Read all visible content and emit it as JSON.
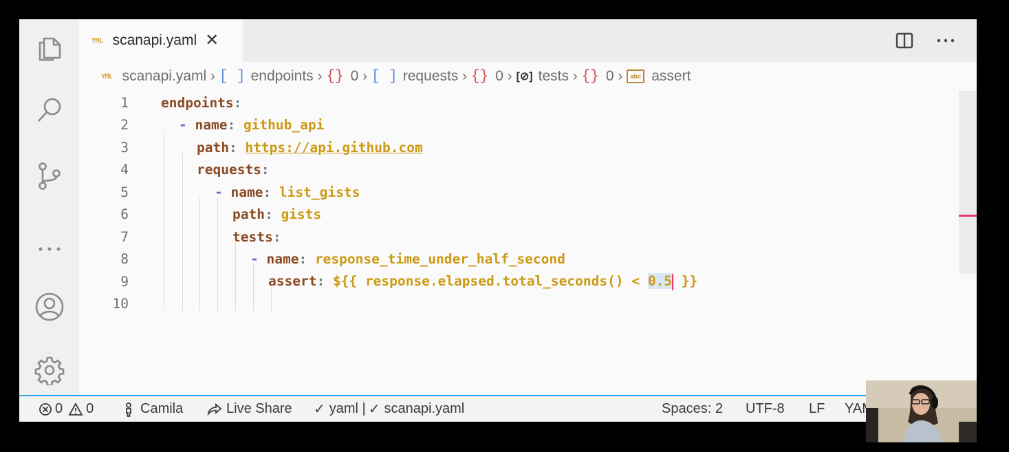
{
  "tab": {
    "icon": "yaml-file-icon",
    "icon_text": "YML",
    "title": "scanapi.yaml",
    "close": "✕"
  },
  "breadcrumb": [
    {
      "kind": "file",
      "label": "scanapi.yaml"
    },
    {
      "kind": "array",
      "symbol": "[ ]",
      "label": "endpoints"
    },
    {
      "kind": "object",
      "symbol": "{}",
      "label": "0"
    },
    {
      "kind": "array",
      "symbol": "[ ]",
      "label": "requests"
    },
    {
      "kind": "object",
      "symbol": "{}",
      "label": "0"
    },
    {
      "kind": "namespace",
      "symbol": "[⊘]",
      "label": "tests"
    },
    {
      "kind": "object",
      "symbol": "{}",
      "label": "0"
    },
    {
      "kind": "string",
      "symbol": "abc",
      "label": "assert"
    }
  ],
  "editor": {
    "lines": [
      {
        "num": "1",
        "dash": "",
        "key": "endpoints",
        "colon": ":",
        "value": ""
      },
      {
        "num": "2",
        "dash": "- ",
        "key": "name",
        "colon": ": ",
        "value": "github_api"
      },
      {
        "num": "3",
        "dash": "",
        "key": "path",
        "colon": ": ",
        "value": "https://api.github.com"
      },
      {
        "num": "4",
        "dash": "",
        "key": "requests",
        "colon": ":",
        "value": ""
      },
      {
        "num": "5",
        "dash": "- ",
        "key": "name",
        "colon": ": ",
        "value": "list_gists"
      },
      {
        "num": "6",
        "dash": "",
        "key": "path",
        "colon": ": ",
        "value": "gists"
      },
      {
        "num": "7",
        "dash": "",
        "key": "tests",
        "colon": ":",
        "value": ""
      },
      {
        "num": "8",
        "dash": "- ",
        "key": "name",
        "colon": ": ",
        "value": "response_time_under_half_second"
      },
      {
        "num": "9",
        "dash": "",
        "key": "assert",
        "colon": ": ",
        "value_pre": "${{ response.elapsed.total_seconds() < ",
        "value_sel": "0.5",
        "value_post": " }}"
      },
      {
        "num": "10",
        "dash": "",
        "key": "",
        "colon": "",
        "value": ""
      }
    ]
  },
  "status": {
    "errors": "0",
    "warnings": "0",
    "user": "Camila",
    "live_share": "Live Share",
    "yaml_check": "yaml | ",
    "file_check": "scanapi.yaml",
    "spaces": "Spaces: 2",
    "encoding": "UTF-8",
    "eol": "LF",
    "language": "YAML"
  },
  "colors": {
    "accent": "#2aa1e6",
    "cursor": "#e8396b",
    "key": "#8a4b24",
    "value": "#cc9b14"
  }
}
